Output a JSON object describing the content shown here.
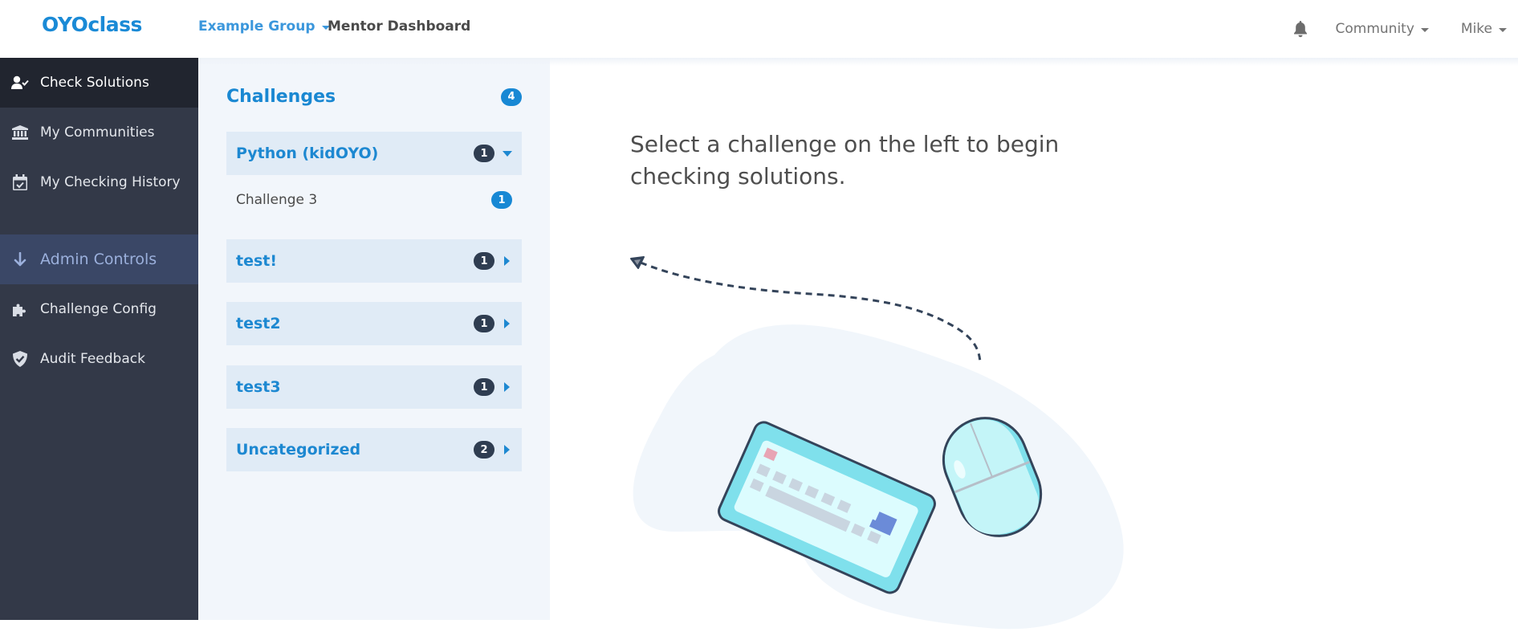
{
  "navbar": {
    "logo": "OYOclass",
    "group_selector": "Example Group",
    "page_title": "Mentor Dashboard",
    "notifications_icon": "bell-icon",
    "community_menu": "Community",
    "user_menu": "Mike"
  },
  "sidebar": {
    "items": [
      {
        "label": "Check Solutions",
        "icon": "user-check-icon",
        "active": true
      },
      {
        "label": "My Communities",
        "icon": "institution-icon",
        "active": false
      },
      {
        "label": "My Checking History",
        "icon": "calendar-check-icon",
        "active": false
      }
    ],
    "admin_section": {
      "label": "Admin Controls",
      "icon": "arrow-down-icon"
    },
    "admin_items": [
      {
        "label": "Challenge Config",
        "icon": "puzzle-icon"
      },
      {
        "label": "Audit Feedback",
        "icon": "shield-check-icon"
      }
    ]
  },
  "challenges": {
    "title": "Challenges",
    "total": "4",
    "categories": [
      {
        "label": "Python (kidOYO)",
        "count": "1",
        "expanded": true,
        "items": [
          {
            "label": "Challenge 3",
            "count": "1"
          }
        ]
      },
      {
        "label": "test!",
        "count": "1",
        "expanded": false
      },
      {
        "label": "test2",
        "count": "1",
        "expanded": false
      },
      {
        "label": "test3",
        "count": "1",
        "expanded": false
      },
      {
        "label": "Uncategorized",
        "count": "2",
        "expanded": false
      }
    ]
  },
  "main": {
    "instruction": "Select a challenge on the left to begin checking solutions.",
    "illustration": "keyboard-and-mouse-illustration"
  },
  "colors": {
    "brand_blue": "#1a8ad6",
    "sidebar_bg": "#333948",
    "sidebar_active_bg": "#21252f",
    "admin_section_bg": "#3a4766",
    "panel_bg": "#f2f6fb",
    "category_bg": "#e0ebf6",
    "badge_blue": "#1888d4",
    "badge_dark": "#2f3d51"
  }
}
